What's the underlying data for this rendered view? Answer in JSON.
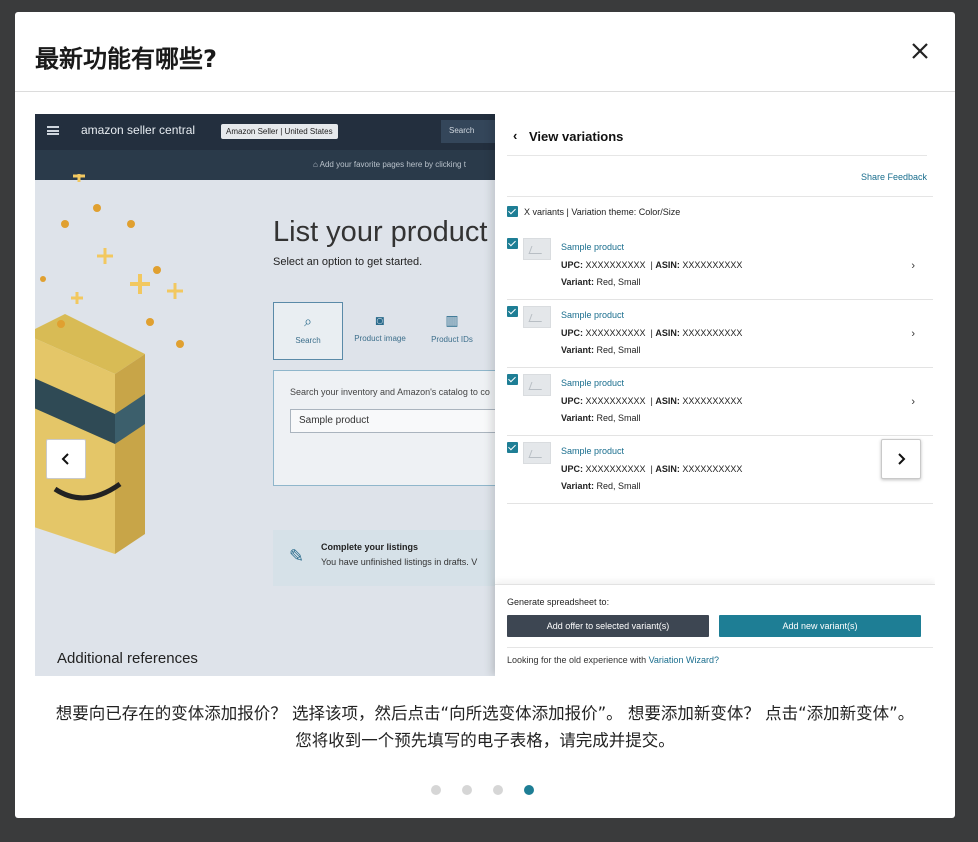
{
  "modal": {
    "title": "最新功能有哪些?",
    "close_icon": "close-icon"
  },
  "background": {
    "logo": "amazon seller central",
    "badge": "Amazon Seller | United States",
    "search_button": "Search",
    "bookmark_hint": "Add your favorite pages here by clicking t",
    "heading": "List your product",
    "subheading": "Select an option to get started.",
    "options": [
      "Search",
      "Product image",
      "Product IDs"
    ],
    "search_hint": "Search your inventory and Amazon's catalog to co",
    "search_value": "Sample product",
    "drafts_title": "Complete your listings",
    "drafts_sub": "You have unfinished listings in drafts. V",
    "references": "Additional references"
  },
  "panel": {
    "back_icon": "chevron-left-icon",
    "title": "View variations",
    "share_feedback": "Share Feedback",
    "theme_row": "X variants | Variation theme: Color/Size",
    "variants": [
      {
        "name": "Sample product",
        "upc_label": "UPC:",
        "upc": "XXXXXXXXXX",
        "asin_label": "ASIN:",
        "asin": "XXXXXXXXXX",
        "variant_label": "Variant:",
        "variant": "Red, Small"
      },
      {
        "name": "Sample product",
        "upc_label": "UPC:",
        "upc": "XXXXXXXXXX",
        "asin_label": "ASIN:",
        "asin": "XXXXXXXXXX",
        "variant_label": "Variant:",
        "variant": "Red, Small"
      },
      {
        "name": "Sample product",
        "upc_label": "UPC:",
        "upc": "XXXXXXXXXX",
        "asin_label": "ASIN:",
        "asin": "XXXXXXXXXX",
        "variant_label": "Variant:",
        "variant": "Red, Small"
      },
      {
        "name": "Sample product",
        "upc_label": "UPC:",
        "upc": "XXXXXXXXXX",
        "asin_label": "ASIN:",
        "asin": "XXXXXXXXXX",
        "variant_label": "Variant:",
        "variant": "Red, Small"
      }
    ],
    "generate_label": "Generate spreadsheet to:",
    "offer_button": "Add offer to selected variant(s)",
    "add_button": "Add new variant(s)",
    "wizard_text": "Looking for the old experience with ",
    "wizard_link": "Variation Wizard?"
  },
  "caption": "想要向已存在的变体添加报价？ 选择该项，然后点击“向所选变体添加报价”。 想要添加新变体？ 点击“添加新变体”。 您将收到一个预先填写的电子表格，请完成并提交。",
  "pagination": {
    "total": 4,
    "active_index": 3
  },
  "colors": {
    "accent": "#1e7e95",
    "dark_button": "#3d4652",
    "link": "#1a6e8e",
    "backdrop": "#3a3b3c"
  }
}
